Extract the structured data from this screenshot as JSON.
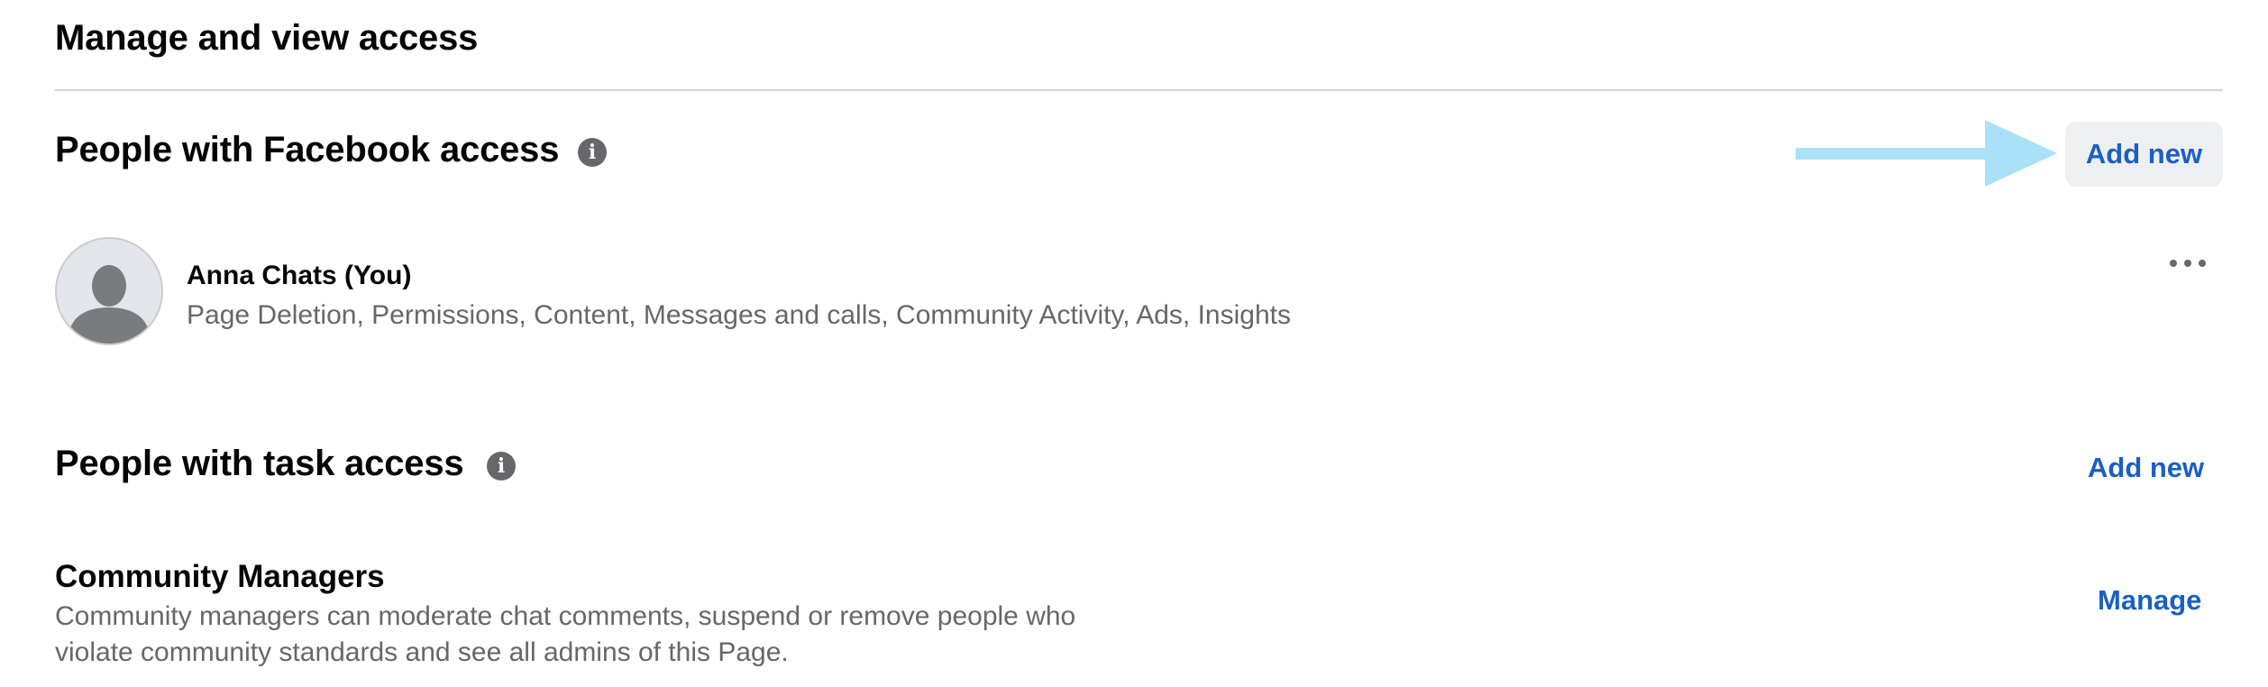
{
  "page": {
    "title": "Manage and view access"
  },
  "facebook_access": {
    "title": "People with Facebook access",
    "info_icon": "info-icon",
    "add_button": "Add new",
    "people": [
      {
        "name": "Anna Chats (You)",
        "permissions": "Page Deletion, Permissions, Content, Messages and calls, Community Activity, Ads, Insights",
        "avatar_icon": "default-avatar-icon",
        "more_icon": "more-options-icon"
      }
    ]
  },
  "task_access": {
    "title": "People with task access",
    "info_icon": "info-icon",
    "add_button": "Add new",
    "roles": [
      {
        "title": "Community Managers",
        "description_line1": "Community managers can moderate chat comments, suspend or remove people who",
        "description_line2": "violate community standards and see all admins of this Page.",
        "action": "Manage"
      }
    ]
  },
  "annotation": {
    "arrow_icon": "pointer-arrow-icon",
    "color": "#a8e1f8"
  },
  "colors": {
    "link": "#1b5fc3",
    "secondary_text": "#65676b",
    "button_bg": "#eeeff1"
  }
}
